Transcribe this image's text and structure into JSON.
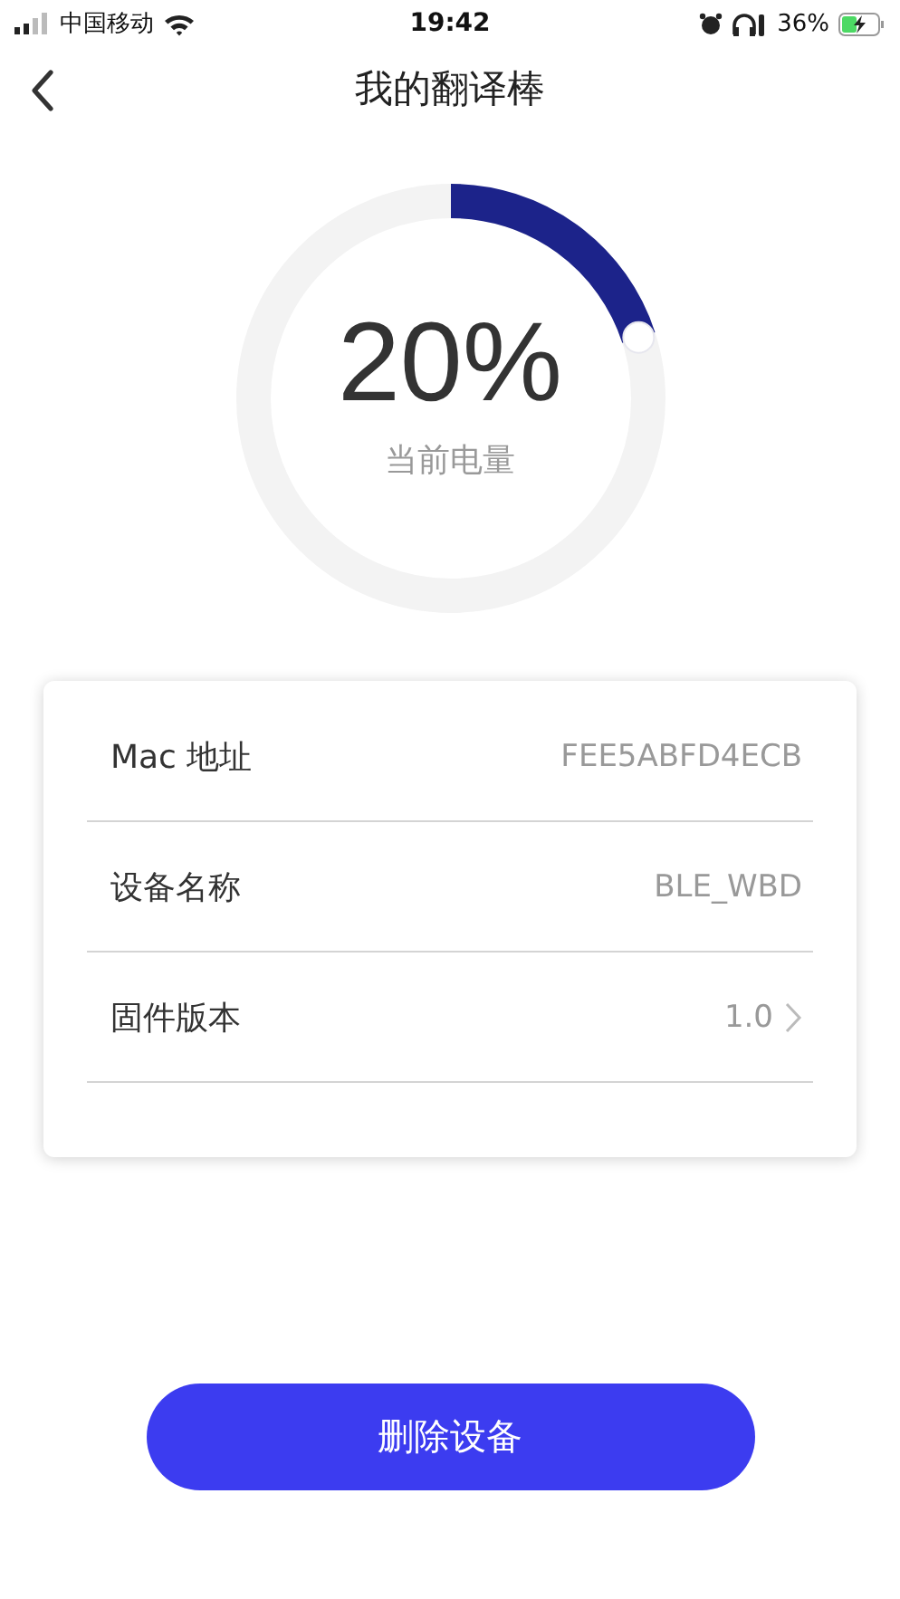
{
  "status_bar": {
    "carrier": "中国移动",
    "time": "19:42",
    "battery_percent": "36%"
  },
  "header": {
    "title": "我的翻译棒"
  },
  "battery_gauge": {
    "reading": "20%",
    "caption": "当前电量"
  },
  "info_rows": [
    {
      "kind": "info",
      "label": "Mac 地址",
      "value": "FEE5ABFD4ECB"
    },
    {
      "kind": "info",
      "label": "设备名称",
      "value": "BLE_WBD"
    },
    {
      "kind": "link",
      "label": "固件版本",
      "value": "1.0"
    }
  ],
  "delete_button": {
    "label": "删除设备"
  }
}
